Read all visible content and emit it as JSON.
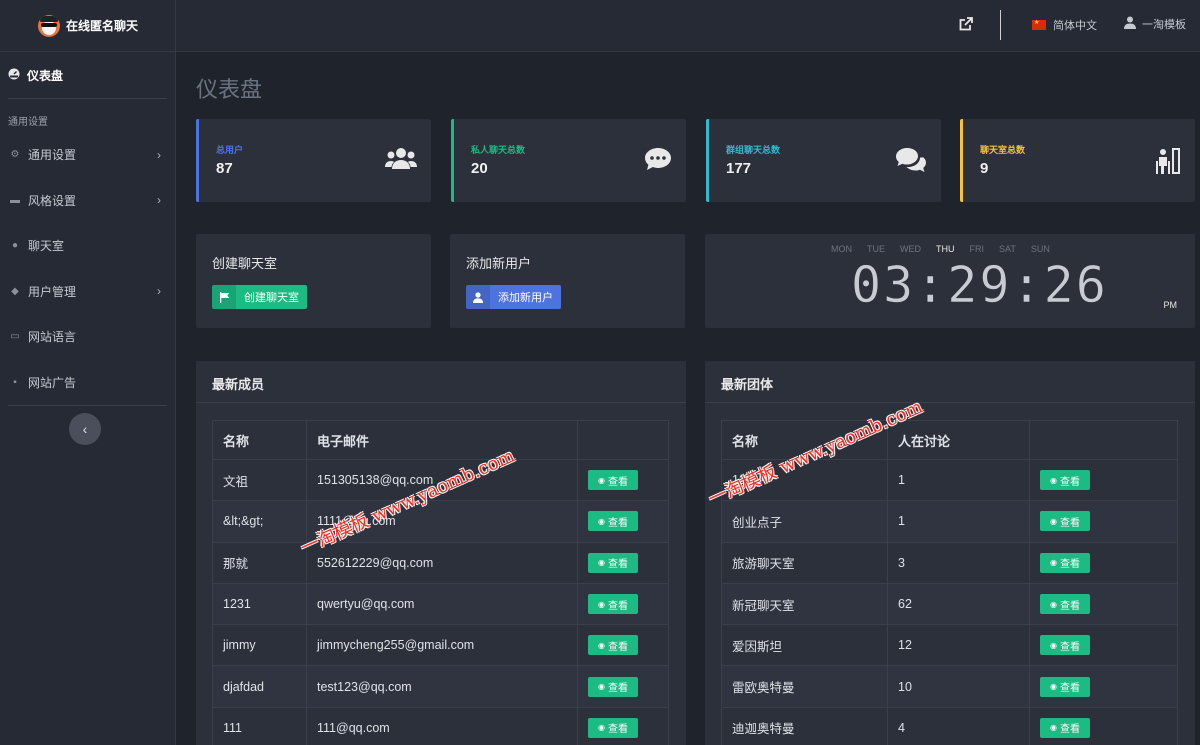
{
  "brand": {
    "title": "在线匿名聊天"
  },
  "sidebar": {
    "dashboard": "仪表盘",
    "section": "通用设置",
    "items": [
      {
        "label": "通用设置",
        "icon": "gear-icon",
        "has_children": true
      },
      {
        "label": "风格设置",
        "icon": "palette-icon",
        "has_children": true
      },
      {
        "label": "聊天室",
        "icon": "chat-icon",
        "has_children": false
      },
      {
        "label": "用户管理",
        "icon": "users-icon",
        "has_children": true
      },
      {
        "label": "网站语言",
        "icon": "language-icon",
        "has_children": false
      },
      {
        "label": "网站广告",
        "icon": "ad-icon",
        "has_children": false
      }
    ]
  },
  "topbar": {
    "language": "简体中文",
    "user": "一淘模板"
  },
  "page": {
    "title": "仪表盘"
  },
  "stats": [
    {
      "label": "总用户",
      "value": "87",
      "color": "#4e73df",
      "icon": "users-icon"
    },
    {
      "label": "私人聊天总数",
      "value": "20",
      "color": "#1cbb84",
      "icon": "comment-icon"
    },
    {
      "label": "群组聊天总数",
      "value": "177",
      "color": "#36b9cc",
      "icon": "comments-icon"
    },
    {
      "label": "聊天室总数",
      "value": "9",
      "color": "#f6c23e",
      "icon": "room-icon"
    }
  ],
  "actions": {
    "create_room": {
      "title": "创建聊天室",
      "button": "创建聊天室"
    },
    "add_user": {
      "title": "添加新用户",
      "button": "添加新用户"
    }
  },
  "clock": {
    "days": [
      "MON",
      "TUE",
      "WED",
      "THU",
      "FRI",
      "SAT",
      "SUN"
    ],
    "active_day": "THU",
    "time": "03:29:26",
    "ampm": "PM"
  },
  "members": {
    "title": "最新成员",
    "columns": [
      "名称",
      "电子邮件",
      ""
    ],
    "rows": [
      {
        "name": "文祖",
        "email": "151305138@qq.com"
      },
      {
        "name": "&lt;&gt;",
        "email": "1111@qq.com"
      },
      {
        "name": "那就",
        "email": "552612229@qq.com"
      },
      {
        "name": "1231",
        "email": "qwertyu@qq.com"
      },
      {
        "name": "jimmy",
        "email": "jimmycheng255@gmail.com"
      },
      {
        "name": "djafdad",
        "email": "test123@qq.com"
      },
      {
        "name": "111",
        "email": "111@qq.com"
      }
    ],
    "view_label": "查看"
  },
  "groups": {
    "title": "最新团体",
    "columns": [
      "名称",
      "人在讨论",
      ""
    ],
    "rows": [
      {
        "name": "123",
        "count": "1"
      },
      {
        "name": "创业点子",
        "count": "1"
      },
      {
        "name": "旅游聊天室",
        "count": "3"
      },
      {
        "name": "新冠聊天室",
        "count": "62"
      },
      {
        "name": "爱因斯坦",
        "count": "12"
      },
      {
        "name": "雷欧奥特曼",
        "count": "10"
      },
      {
        "name": "迪迦奥特曼",
        "count": "4"
      }
    ],
    "view_label": "查看"
  },
  "watermark": "一淘模板 www.yaomb.com"
}
